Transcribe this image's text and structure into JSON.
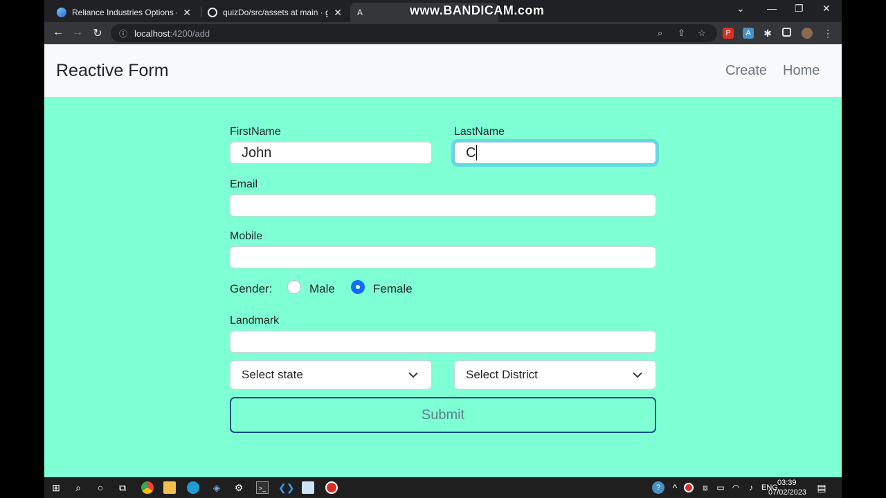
{
  "browser": {
    "tabs": [
      {
        "title": "Reliance Industries Options - Live",
        "favicon_color": "#4aa0e6"
      },
      {
        "title": "quizDo/src/assets at main · gaura",
        "favicon_color": "#e8eaed"
      },
      {
        "title": "A",
        "favicon_color": "#e8eaed"
      }
    ],
    "watermark": "www.BANDICAM.com",
    "url_host": "localhost",
    "url_path": ":4200/add"
  },
  "navbar": {
    "brand": "Reactive Form",
    "links": [
      "Create",
      "Home"
    ]
  },
  "form": {
    "first_name_label": "FirstName",
    "first_name_value": "John",
    "last_name_label": "LastName",
    "last_name_value": "C",
    "email_label": "Email",
    "email_value": "",
    "mobile_label": "Mobile",
    "mobile_value": "",
    "gender_label": "Gender:",
    "gender_options": [
      "Male",
      "Female"
    ],
    "gender_selected": "Female",
    "landmark_label": "Landmark",
    "landmark_value": "",
    "state_select": "Select state",
    "district_select": "Select District",
    "submit_label": "Submit"
  },
  "taskbar": {
    "language": "ENG",
    "time": "03:39",
    "date": "07/02/2023"
  },
  "colors": {
    "page_bg": "#7fffd4",
    "navbar_bg": "#f8f9fa",
    "radio_checked": "#0d6efd",
    "submit_border": "#0d4f7a"
  }
}
